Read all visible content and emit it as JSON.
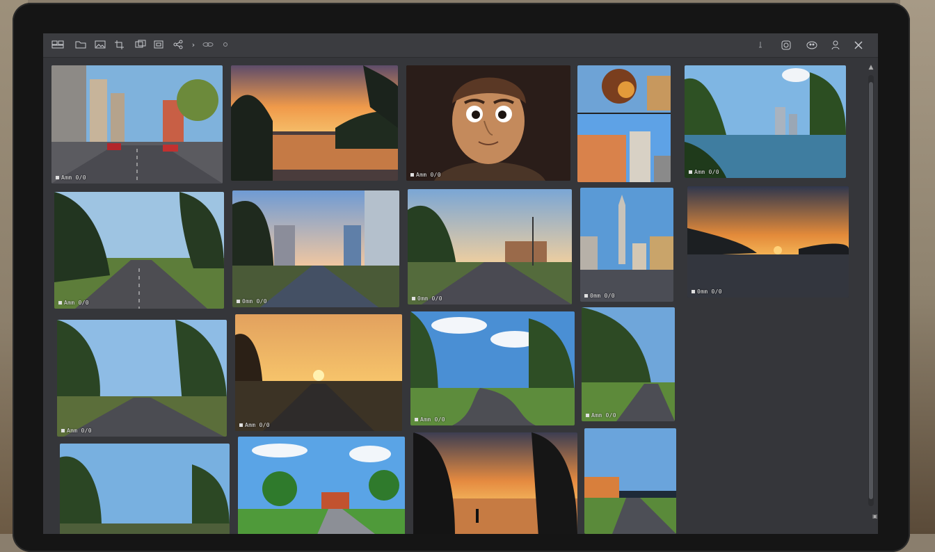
{
  "toolbar": {
    "left_items": [
      {
        "icon": "grid-icon",
        "label": "",
        "tip": ""
      },
      {
        "icon": "folder-icon",
        "label": ""
      },
      {
        "icon": "image-icon",
        "label": ""
      },
      {
        "icon": "crop-icon",
        "label": ""
      },
      {
        "icon": "photos-icon",
        "label": ""
      },
      {
        "icon": "frame-icon",
        "label": ""
      },
      {
        "icon": "share-icon",
        "label": ""
      },
      {
        "icon": "chevron-right-icon",
        "label": "›"
      },
      {
        "icon": "link-icon",
        "label": ""
      },
      {
        "icon": "settings-dot-icon",
        "label": ""
      }
    ],
    "right_items": [
      {
        "icon": "info-icon"
      },
      {
        "icon": "refresh-icon"
      },
      {
        "icon": "palette-icon"
      },
      {
        "icon": "user-icon"
      },
      {
        "icon": "tools-icon"
      }
    ]
  },
  "thumbnails": [
    {
      "scene": "city-street-day",
      "caption": "Amm 0/0",
      "row": 1,
      "col": 1
    },
    {
      "scene": "lake-sunset",
      "caption": "",
      "row": 1,
      "col": 2
    },
    {
      "scene": "cartoon-man-portrait",
      "caption": "Amm 0/0",
      "row": 1,
      "col": 3
    },
    {
      "scene": "buildings-split",
      "caption": "",
      "row": 1,
      "col": 4
    },
    {
      "scene": "river-trees-day",
      "caption": "Amm 0/0",
      "row": 1,
      "col": 5
    },
    {
      "scene": "road-trees-day",
      "caption": "Amm 0/0",
      "row": 2,
      "col": 1
    },
    {
      "scene": "city-avenue-dusk",
      "caption": "0mm 0/0",
      "row": 2,
      "col": 2
    },
    {
      "scene": "suburban-road-dusk",
      "caption": "0mm 0/0",
      "row": 2,
      "col": 3
    },
    {
      "scene": "city-tower-road",
      "caption": "0mm 0/0",
      "row": 2,
      "col": 4
    },
    {
      "scene": "road-sunset-dark",
      "caption": "0mm 0/0",
      "row": 2,
      "col": 5
    },
    {
      "scene": "road-forest-day",
      "caption": "Amm 0/0",
      "row": 3,
      "col": 1
    },
    {
      "scene": "road-sunset-orange",
      "caption": "Amm 0/0",
      "row": 3,
      "col": 2
    },
    {
      "scene": "curved-road-clouds",
      "caption": "Amm 0/0",
      "row": 3,
      "col": 3
    },
    {
      "scene": "park-road-trees",
      "caption": "Amm 0/0",
      "row": 3,
      "col": 4
    },
    {
      "scene": "road-trees-blue",
      "caption": "",
      "row": 4,
      "col": 1
    },
    {
      "scene": "cartoon-park-road",
      "caption": "",
      "row": 4,
      "col": 2
    },
    {
      "scene": "lake-silhouette-sunset",
      "caption": "",
      "row": 4,
      "col": 3
    },
    {
      "scene": "road-orange-building",
      "caption": "",
      "row": 4,
      "col": 4
    }
  ],
  "colors": {
    "screen_bg": "#35363a",
    "toolbar_bg": "#3b3c40",
    "bezel": "#151515"
  }
}
